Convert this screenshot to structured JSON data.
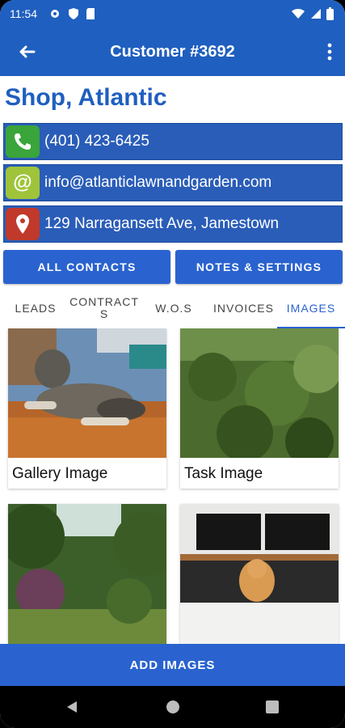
{
  "status_bar": {
    "time": "11:54"
  },
  "app_bar": {
    "title": "Customer #3692"
  },
  "customer": {
    "name": "Shop, Atlantic",
    "phone": "(401) 423-6425",
    "email": "info@atlanticlawnandgarden.com",
    "address": "129 Narragansett Ave, Jamestown"
  },
  "buttons": {
    "all_contacts": "ALL CONTACTS",
    "notes_settings": "NOTES & SETTINGS"
  },
  "tabs": [
    {
      "label": "LEADS"
    },
    {
      "label": "CONTRACT\nS"
    },
    {
      "label": "W.O.S"
    },
    {
      "label": "INVOICES"
    },
    {
      "label": "IMAGES",
      "active": true
    }
  ],
  "images": [
    {
      "caption": "Gallery Image"
    },
    {
      "caption": "Task Image"
    },
    {
      "caption": ""
    },
    {
      "caption": ""
    }
  ],
  "add_images": "ADD IMAGES",
  "colors": {
    "primary": "#1f5fbf",
    "button": "#2a63cf",
    "phone_icon_bg": "#3aa53a",
    "email_icon_bg": "#9fc43a",
    "address_icon_bg": "#c0392b"
  }
}
